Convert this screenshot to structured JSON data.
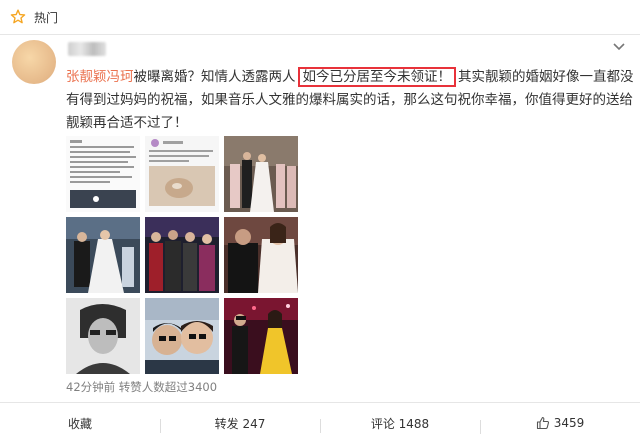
{
  "header": {
    "label": "热门",
    "icon": "hot-star-icon"
  },
  "post": {
    "text_part1_mention": "张靓颖冯珂",
    "text_part2": "被曝离婚？知情人透露两人",
    "text_highlight": "如今已分居至今未领证！",
    "text_part3": "其实靓颖的婚姻好像一直都没有得到过妈妈的祝福，如果音乐人文雅的爆料属实的话，那么这句祝你幸福，你值得更好的送给靓颖再合适不过了！",
    "meta": "42分钟前 转赞人数超过3400",
    "photo_count": 9
  },
  "actions": {
    "favorite": "收藏",
    "repost": "转发 247",
    "comment": "评论 1488",
    "like": "3459"
  },
  "colors": {
    "mention": "#eb7350",
    "highlight_border": "#e8323a",
    "hot_icon": "#f5a623"
  }
}
